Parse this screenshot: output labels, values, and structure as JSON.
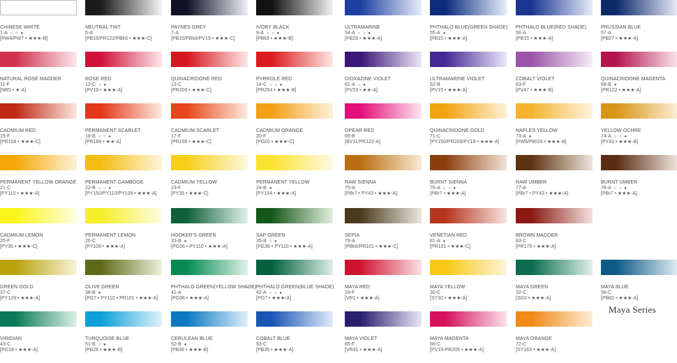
{
  "series_title": "Maya Series",
  "colors": [
    {
      "name": "CHINESE WHITE",
      "code": "1-A",
      "marks": "○ ○ ●",
      "pigments": "[PW4/PW7",
      "rating": "★★★-B]",
      "swatch": [
        "#ffffff",
        "#ffffff"
      ],
      "border": true
    },
    {
      "name": "NEUTRAL TINT",
      "code": "5-A",
      "marks": "",
      "pigments": "[PB15/PR122/PBk6",
      "rating": "★★★-C]",
      "swatch": [
        "#1b1b1b",
        "#f4f4f4"
      ]
    },
    {
      "name": "PAYNES GREY",
      "code": "7-A",
      "marks": "",
      "pigments": "[PB15/PBk6/PV19",
      "rating": "★★★-C]",
      "swatch": [
        "#0d1226",
        "#eef0f6"
      ]
    },
    {
      "name": "IVORY BLACK",
      "code": "9-A",
      "marks": "○ ○ ●",
      "pigments": "[PBk9",
      "rating": "★★★-B]",
      "swatch": [
        "#111111",
        "#f2f2f2"
      ]
    },
    {
      "name": "ULTRAMARINE",
      "code": "54-A",
      "marks": "○ ○ ●",
      "pigments": "[PB29",
      "rating": "★★★-A]",
      "swatch": [
        "#1d3fa0",
        "#e8eefc"
      ]
    },
    {
      "name": "PHTHALO BLUE(GREEN SHADE)",
      "code": "55-A",
      "marks": "●",
      "pigments": "[PB15",
      "rating": "★★★-A]",
      "swatch": [
        "#0b2c7a",
        "#e6eefc"
      ]
    },
    {
      "name": "PHTHALO BLUE(RED SHADE)",
      "code": "56-A",
      "marks": "",
      "pigments": "[PB15",
      "rating": "★★★-A]",
      "swatch": [
        "#1a3690",
        "#e6ecfa"
      ]
    },
    {
      "name": "PRUSSIAN BLUE",
      "code": "57-A",
      "marks": "",
      "pigments": "[PB27",
      "rating": "★★★-A]",
      "swatch": [
        "#0d2a6a",
        "#e7ecf7"
      ]
    },
    {
      "name": "NATURAL ROSE MADDER",
      "code": "11-F",
      "marks": "",
      "pigments": "[NR9",
      "rating": "★-A]",
      "swatch": [
        "#d0324d",
        "#fbe8ec"
      ]
    },
    {
      "name": "ROSE RED",
      "code": "12-C",
      "marks": "○ ●",
      "pigments": "[PV19",
      "rating": "★★★-A]",
      "swatch": [
        "#d0123a",
        "#fde6ea"
      ]
    },
    {
      "name": "QUINACRIDONE RED",
      "code": "13-C",
      "marks": "",
      "pigments": "[PR209",
      "rating": "★★★-C]",
      "swatch": [
        "#d7171f",
        "#fde6e4"
      ]
    },
    {
      "name": "PYRROLE RED",
      "code": "14-C",
      "marks": "○ ○ ●",
      "pigments": "[PR254",
      "rating": "★★★-B]",
      "swatch": [
        "#dc1b1f",
        "#fde8e2"
      ]
    },
    {
      "name": "DIOXAZINE VIOLET",
      "code": "61-A",
      "marks": "○ ●",
      "pigments": "[PV23",
      "rating": "★★-A]",
      "swatch": [
        "#3b1577",
        "#ede5f8"
      ]
    },
    {
      "name": "ULTRAMARINE VIOLET",
      "code": "62-B",
      "marks": "",
      "pigments": "[PV15",
      "rating": "★★★-A]",
      "swatch": [
        "#422a94",
        "#ece6fa"
      ]
    },
    {
      "name": "COBALT VIOLET",
      "code": "63-F",
      "marks": "",
      "pigments": "[PV47",
      "rating": "★★★-B]",
      "swatch": [
        "#9a55a8",
        "#f6ecf7"
      ]
    },
    {
      "name": "QUINACRIDONE MAGENTA",
      "code": "68-B",
      "marks": "●",
      "pigments": "[PR122",
      "rating": "★★★-A]",
      "swatch": [
        "#b5154f",
        "#fbe4ec"
      ]
    },
    {
      "name": "CADMIUM RED",
      "code": "15-F",
      "marks": "",
      "pigments": "[PR108",
      "rating": "★★★-C]",
      "swatch": [
        "#c02915",
        "#fce6df"
      ]
    },
    {
      "name": "PERMANENT SCARLET",
      "code": "16-B",
      "marks": "○ ○ ●",
      "pigments": "[PR188",
      "rating": "★★-A]",
      "swatch": [
        "#e4361a",
        "#fde9df"
      ]
    },
    {
      "name": "CADMIUM SCARLET",
      "code": "17-F",
      "marks": "",
      "pigments": "[PR108",
      "rating": "★★★-C]",
      "swatch": [
        "#e8451a",
        "#fdebdf"
      ]
    },
    {
      "name": "CADMIUM ORANGE",
      "code": "20-F",
      "marks": "",
      "pigments": "[PO20",
      "rating": "★★★-C]",
      "swatch": [
        "#f2a016",
        "#fdf1dc"
      ]
    },
    {
      "name": "OPEAR RED",
      "code": "69-B",
      "marks": "",
      "pigments": "[BV11/PR122-A]",
      "rating": "",
      "swatch": [
        "#e30e79",
        "#fde4f0"
      ]
    },
    {
      "name": "QUINACRIDONE GOLD",
      "code": "71-C",
      "marks": "",
      "pigments": "[PY150/PR209/PY19",
      "rating": "★★★-A]",
      "swatch": [
        "#f2a310",
        "#fdf1d6"
      ]
    },
    {
      "name": "NAPLES YELLOW",
      "code": "73-A",
      "marks": "●",
      "pigments": "[PW6/PBr24",
      "rating": "★★★-B]",
      "swatch": [
        "#f4b430",
        "#fdf3de"
      ]
    },
    {
      "name": "YELLOW OCHRE",
      "code": "74-A",
      "marks": "○ ○ ●",
      "pigments": "[PY43",
      "rating": "★★★-B]",
      "swatch": [
        "#d99516",
        "#fbefd6"
      ]
    },
    {
      "name": "PERMANENT YELLOW ORANGE",
      "code": "21-C",
      "marks": "",
      "pigments": "[PY110",
      "rating": "★★★-A]",
      "swatch": [
        "#f6a808",
        "#fdf2d8"
      ]
    },
    {
      "name": "PERMANENT GAMBOGE",
      "code": "22-B",
      "marks": "○ ○ ●",
      "pigments": "[PY150/PY110/PY109",
      "rating": "★★★-A]",
      "swatch": [
        "#f5bc12",
        "#fdf5da"
      ]
    },
    {
      "name": "CADMIUM YELLOW",
      "code": "23-F",
      "marks": "",
      "pigments": "[PY35",
      "rating": "★★★-C]",
      "swatch": [
        "#f7cf1a",
        "#fdf8de"
      ]
    },
    {
      "name": "PERMANENT YELLOW",
      "code": "24-B",
      "marks": "●",
      "pigments": "[PY154",
      "rating": "★★★-A]",
      "swatch": [
        "#fbe231",
        "#fefbe3"
      ]
    },
    {
      "name": "RAW SIENNA",
      "code": "75-A",
      "marks": "",
      "pigments": "[PBr7",
      "rating": "PY43 • ★★★-A]",
      "swatch": [
        "#b96f10",
        "#f8ead4"
      ]
    },
    {
      "name": "BURNT SIENNA",
      "code": "76-A",
      "marks": "○ ○ ●",
      "pigments": "[PBr7",
      "rating": "★★★-A]",
      "swatch": [
        "#8a3f0d",
        "#f4e3d6"
      ]
    },
    {
      "name": "RAW UMBER",
      "code": "77-A",
      "marks": "",
      "pigments": "[PBr7",
      "rating": "PY43 • ★★★-A]",
      "swatch": [
        "#5e3410",
        "#efe5dc"
      ]
    },
    {
      "name": "BURNT UMBER",
      "code": "78-A",
      "marks": "○ ○ ●",
      "pigments": "[PBr7",
      "rating": "★★★-A]",
      "swatch": [
        "#5a2c12",
        "#efe4dc"
      ]
    },
    {
      "name": "CADMIUM LEMON",
      "code": "25-F",
      "marks": "",
      "pigments": "[PY35",
      "rating": "★★★-C]",
      "swatch": [
        "#fbf61a",
        "#fefde0"
      ]
    },
    {
      "name": "PERMANENT LEMON",
      "code": "26-C",
      "marks": "",
      "pigments": "[PY109",
      "rating": "★★★-A]",
      "swatch": [
        "#f6ee2a",
        "#fefce0"
      ]
    },
    {
      "name": "HOOKER'S GREEN",
      "code": "33-B",
      "marks": "●",
      "pigments": "[PG36",
      "rating": "PY110 • ★★★-A]",
      "swatch": [
        "#10613a",
        "#e2f1e8"
      ]
    },
    {
      "name": "SAP GREEN",
      "code": "35-B",
      "marks": "○ ●",
      "pigments": "[PG36",
      "rating": "PY110 • ★★★-A]",
      "swatch": [
        "#16571b",
        "#e4f0df"
      ]
    },
    {
      "name": "SEPIA",
      "code": "79-A",
      "marks": "",
      "pigments": "[PBk6/PR101",
      "rating": "★★★-C]",
      "swatch": [
        "#4a3a1e",
        "#ece7dd"
      ]
    },
    {
      "name": "VENETIAN RED",
      "code": "81-A",
      "marks": "●",
      "pigments": "[PR101",
      "rating": "★★★-C]",
      "swatch": [
        "#b5351e",
        "#f8e4df"
      ]
    },
    {
      "name": "BROWN MADDER",
      "code": "83-C",
      "marks": "",
      "pigments": "[PR175",
      "rating": "★★★-A]",
      "swatch": [
        "#8a1a12",
        "#f4e1de"
      ]
    },
    {
      "name": "GREEN GOLD",
      "code": "37-C",
      "marks": "",
      "pigments": "[PY129",
      "rating": "★★★-A]",
      "swatch": [
        "#b9a20d",
        "#f8f3d6"
      ]
    },
    {
      "name": "OLIVE GREEN",
      "code": "38-B",
      "marks": "●",
      "pigments": "[PG7",
      "rating": "PY110 • PR101 • ★★★-A]",
      "swatch": [
        "#5e6a16",
        "#eef0dc"
      ]
    },
    {
      "name": "PHTHALO GREEN(YELLOW SHADE)",
      "code": "41-A",
      "marks": "",
      "pigments": "[PG36",
      "rating": "★★★-A]",
      "swatch": [
        "#058a51",
        "#dff2e8"
      ]
    },
    {
      "name": "PHTHALO GREEN(BLUE SHADE)",
      "code": "42-A",
      "marks": "○ ○ ●",
      "pigments": "[PG7",
      "rating": "★★★-A]",
      "swatch": [
        "#04603f",
        "#dcefe6"
      ]
    },
    {
      "name": "MAYA RED",
      "code": "19-F",
      "marks": "",
      "pigments": "[VR1",
      "rating": "★★★-A]",
      "swatch": [
        "#cf1430",
        "#fbe1e4"
      ]
    },
    {
      "name": "MAYA YELLOW",
      "code": "30-C",
      "marks": "",
      "pigments": "[SY33",
      "rating": "★★★-A]",
      "swatch": [
        "#f9c814",
        "#fdf4d8"
      ]
    },
    {
      "name": "MAYA GREEN",
      "code": "32-C",
      "marks": "",
      "pigments": "[SG3",
      "rating": "★★★-A]",
      "swatch": [
        "#0b6c4f",
        "#def0e8"
      ]
    },
    {
      "name": "MAYA BLUE",
      "code": "58-C",
      "marks": "",
      "pigments": "[PB82",
      "rating": "★★★-A]",
      "swatch": [
        "#0e5a86",
        "#e0ecf4"
      ]
    },
    {
      "name": "VIRIDIAN",
      "code": "43-C",
      "marks": "",
      "pigments": "[PG18",
      "rating": "★★★-A]",
      "swatch": [
        "#0c7a57",
        "#ddf0e6"
      ]
    },
    {
      "name": "TURQUOISE BLUE",
      "code": "51-B",
      "marks": "○ ●",
      "pigments": "[PB28",
      "rating": "★★★-B]",
      "swatch": [
        "#0ba0d8",
        "#e0f2fb"
      ]
    },
    {
      "name": "CERULEAN BLUE",
      "code": "52-B",
      "marks": "●",
      "pigments": "[PB36",
      "rating": "★★★-B]",
      "swatch": [
        "#0a78c2",
        "#dfeefa"
      ]
    },
    {
      "name": "COBALT BLUE",
      "code": "53-C",
      "marks": "",
      "pigments": "[PB36",
      "rating": "★★★-A]",
      "swatch": [
        "#1a55b4",
        "#e2ebf9"
      ]
    },
    {
      "name": "MAYA VIOLET",
      "code": "65-F",
      "marks": "",
      "pigments": "[VR41",
      "rating": "★★★-A]",
      "swatch": [
        "#2a1f6e",
        "#e9e6f5"
      ]
    },
    {
      "name": "MAYA MAGENTA",
      "code": "66-C",
      "marks": "",
      "pigments": "[PV19-PR209",
      "rating": "★★★-A]",
      "swatch": [
        "#d6125b",
        "#fbe1ea"
      ]
    },
    {
      "name": "MAYA ORANGE",
      "code": "72-C",
      "marks": "",
      "pigments": "[SY163",
      "rating": "★★★-A]",
      "swatch": [
        "#f08a18",
        "#fdecd6"
      ]
    }
  ]
}
